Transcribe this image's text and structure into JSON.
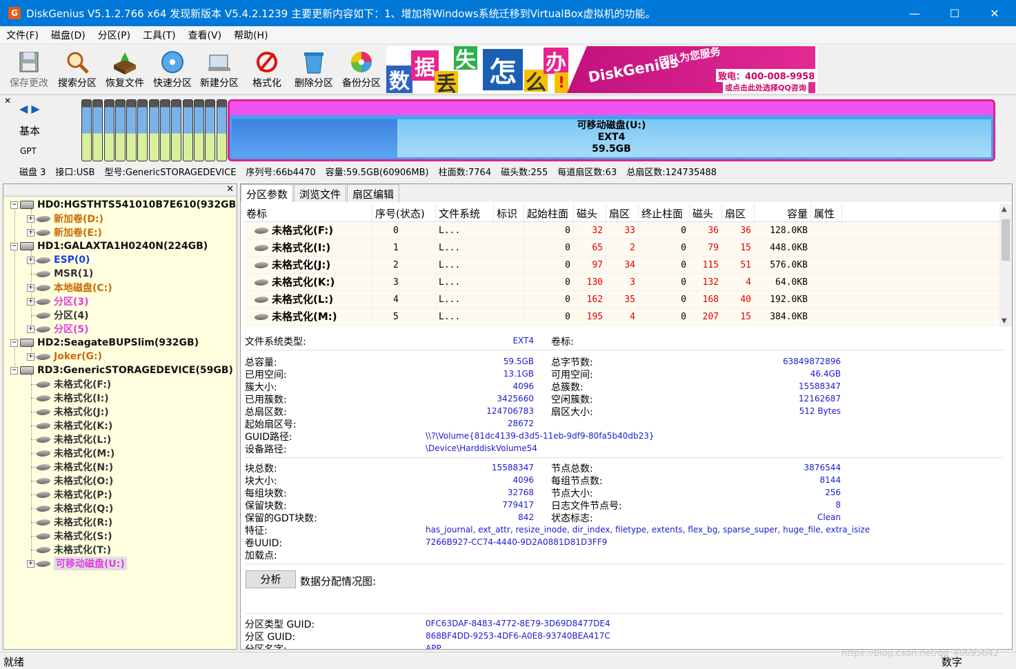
{
  "window": {
    "title": "DiskGenius V5.1.2.766 x64    发现新版本 V5.4.2.1239 主要更新内容如下：1、增加将Windows系统迁移到VirtualBox虚拟机的功能。",
    "icon": "G",
    "minimize": "—",
    "maximize": "☐",
    "close": "✕"
  },
  "menu": [
    "文件(F)",
    "磁盘(D)",
    "分区(P)",
    "工具(T)",
    "查看(V)",
    "帮助(H)"
  ],
  "toolbar": [
    {
      "label": "保存更改",
      "icon": "save-icon",
      "disabled": true
    },
    {
      "label": "搜索分区",
      "icon": "search-icon"
    },
    {
      "label": "恢复文件",
      "icon": "recover-icon"
    },
    {
      "label": "快速分区",
      "icon": "quick-partition-icon"
    },
    {
      "label": "新建分区",
      "icon": "new-partition-icon"
    },
    {
      "label": "格式化",
      "icon": "format-icon"
    },
    {
      "label": "删除分区",
      "icon": "delete-icon"
    },
    {
      "label": "备份分区",
      "icon": "backup-icon"
    }
  ],
  "banner": {
    "chars": [
      "数",
      "据",
      "丢",
      "失",
      "怎",
      "么",
      "办",
      "!"
    ],
    "brand": "DiskGenius",
    "service": "团队为您服务",
    "phone": "致电：400-008-9958",
    "qq": "或点击此处选择QQ咨询"
  },
  "disk": {
    "type": "基本",
    "style": "GPT",
    "partition_name": "可移动磁盘(U:)",
    "partition_fs": "EXT4",
    "partition_size": "59.5GB",
    "info": {
      "disk": "磁盘 3",
      "interface": "接口:USB",
      "model": "型号:GenericSTORAGEDEVICE",
      "serial": "序列号:66b4470",
      "capacity": "容量:59.5GB(60906MB)",
      "cylinders": "柱面数:7764",
      "heads": "磁头数:255",
      "sectors_per_track": "每道扇区数:63",
      "total_sectors": "总扇区数:124735488"
    }
  },
  "tree": [
    {
      "label": "HD0:HGSTHTS541010B7E610(932GB)",
      "level": 0,
      "kind": "disk",
      "color": "black",
      "exp": "−"
    },
    {
      "label": "新加卷(D:)",
      "level": 1,
      "kind": "part",
      "color": "orange",
      "exp": "+"
    },
    {
      "label": "新加卷(E:)",
      "level": 1,
      "kind": "part",
      "color": "orange",
      "exp": "+"
    },
    {
      "label": "HD1:GALAXTA1H0240N(224GB)",
      "level": 0,
      "kind": "disk",
      "color": "black",
      "exp": "−"
    },
    {
      "label": "ESP(0)",
      "level": 1,
      "kind": "part",
      "color": "blue",
      "exp": "+"
    },
    {
      "label": "MSR(1)",
      "level": 1,
      "kind": "part",
      "color": "gray",
      "exp": ""
    },
    {
      "label": "本地磁盘(C:)",
      "level": 1,
      "kind": "part",
      "color": "orange",
      "exp": "+"
    },
    {
      "label": "分区(3)",
      "level": 1,
      "kind": "part",
      "color": "magenta",
      "exp": "+"
    },
    {
      "label": "分区(4)",
      "level": 1,
      "kind": "part",
      "color": "gray",
      "exp": ""
    },
    {
      "label": "分区(5)",
      "level": 1,
      "kind": "part",
      "color": "magenta",
      "exp": "+"
    },
    {
      "label": "HD2:SeagateBUPSlim(932GB)",
      "level": 0,
      "kind": "disk",
      "color": "black",
      "exp": "−"
    },
    {
      "label": "Joker(G:)",
      "level": 1,
      "kind": "part",
      "color": "orange",
      "exp": "+"
    },
    {
      "label": "RD3:GenericSTORAGEDEVICE(59GB)",
      "level": 0,
      "kind": "disk",
      "color": "black",
      "exp": "−"
    },
    {
      "label": "未格式化(F:)",
      "level": 1,
      "kind": "part",
      "color": "gray",
      "exp": ""
    },
    {
      "label": "未格式化(I:)",
      "level": 1,
      "kind": "part",
      "color": "gray",
      "exp": ""
    },
    {
      "label": "未格式化(J:)",
      "level": 1,
      "kind": "part",
      "color": "gray",
      "exp": ""
    },
    {
      "label": "未格式化(K:)",
      "level": 1,
      "kind": "part",
      "color": "gray",
      "exp": ""
    },
    {
      "label": "未格式化(L:)",
      "level": 1,
      "kind": "part",
      "color": "gray",
      "exp": ""
    },
    {
      "label": "未格式化(M:)",
      "level": 1,
      "kind": "part",
      "color": "gray",
      "exp": ""
    },
    {
      "label": "未格式化(N:)",
      "level": 1,
      "kind": "part",
      "color": "gray",
      "exp": ""
    },
    {
      "label": "未格式化(O:)",
      "level": 1,
      "kind": "part",
      "color": "gray",
      "exp": ""
    },
    {
      "label": "未格式化(P:)",
      "level": 1,
      "kind": "part",
      "color": "gray",
      "exp": ""
    },
    {
      "label": "未格式化(Q:)",
      "level": 1,
      "kind": "part",
      "color": "gray",
      "exp": ""
    },
    {
      "label": "未格式化(R:)",
      "level": 1,
      "kind": "part",
      "color": "gray",
      "exp": ""
    },
    {
      "label": "未格式化(S:)",
      "level": 1,
      "kind": "part",
      "color": "gray",
      "exp": ""
    },
    {
      "label": "未格式化(T:)",
      "level": 1,
      "kind": "part",
      "color": "gray",
      "exp": ""
    },
    {
      "label": "可移动磁盘(U:)",
      "level": 1,
      "kind": "part",
      "color": "magenta",
      "exp": "+",
      "selected": true
    }
  ],
  "tabs": [
    "分区参数",
    "浏览文件",
    "扇区编辑"
  ],
  "table": {
    "headers": [
      "卷标",
      "序号(状态)",
      "文件系统",
      "标识",
      "起始柱面",
      "磁头",
      "扇区",
      "终止柱面",
      "磁头",
      "扇区",
      "容量",
      "属性"
    ],
    "rows": [
      [
        "未格式化(F:)",
        "0",
        "L...",
        "",
        "0",
        "32",
        "33",
        "0",
        "36",
        "36",
        "128.0KB",
        ""
      ],
      [
        "未格式化(I:)",
        "1",
        "L...",
        "",
        "0",
        "65",
        "2",
        "0",
        "79",
        "15",
        "448.0KB",
        ""
      ],
      [
        "未格式化(J:)",
        "2",
        "L...",
        "",
        "0",
        "97",
        "34",
        "0",
        "115",
        "51",
        "576.0KB",
        ""
      ],
      [
        "未格式化(K:)",
        "3",
        "L...",
        "",
        "0",
        "130",
        "3",
        "0",
        "132",
        "4",
        "64.0KB",
        ""
      ],
      [
        "未格式化(L:)",
        "4",
        "L...",
        "",
        "0",
        "162",
        "35",
        "0",
        "168",
        "40",
        "192.0KB",
        ""
      ],
      [
        "未格式化(M:)",
        "5",
        "L...",
        "",
        "0",
        "195",
        "4",
        "0",
        "207",
        "15",
        "384.0KB",
        ""
      ]
    ]
  },
  "fs": {
    "type_label": "文件系统类型:",
    "type_value": "EXT4",
    "volume_label": "卷标:",
    "total_cap_label": "总容量:",
    "total_cap": "59.5GB",
    "total_bytes_label": "总字节数:",
    "total_bytes": "63849872896",
    "used_label": "已用空间:",
    "used": "13.1GB",
    "free_label": "可用空间:",
    "free": "46.4GB",
    "cluster_size_label": "簇大小:",
    "cluster_size": "4096",
    "total_clusters_label": "总簇数:",
    "total_clusters": "15588347",
    "used_clusters_label": "已用簇数:",
    "used_clusters": "3425660",
    "free_clusters_label": "空闲簇数:",
    "free_clusters": "12162687",
    "total_sectors_label": "总扇区数:",
    "total_sectors": "124706783",
    "sector_size_label": "扇区大小:",
    "sector_size": "512 Bytes",
    "start_sector_label": "起始扇区号:",
    "start_sector": "28672",
    "guid_path_label": "GUID路径:",
    "guid_path": "\\\\?\\Volume{81dc4139-d3d5-11eb-9df9-80fa5b40db23}",
    "device_path_label": "设备路径:",
    "device_path": "\\Device\\HarddiskVolume54"
  },
  "ext": {
    "blocks_label": "块总数:",
    "blocks": "15588347",
    "inodes_label": "节点总数:",
    "inodes": "3876544",
    "block_size_label": "块大小:",
    "block_size": "4096",
    "inodes_per_group_label": "每组节点数:",
    "inodes_per_group": "8144",
    "blocks_per_group_label": "每组块数:",
    "blocks_per_group": "32768",
    "inode_size_label": "节点大小:",
    "inode_size": "256",
    "reserved_blocks_label": "保留块数:",
    "reserved_blocks": "779417",
    "journal_inode_label": "日志文件节点号:",
    "journal_inode": "8",
    "reserved_gdt_label": "保留的GDT块数:",
    "reserved_gdt": "842",
    "state_label": "状态标志:",
    "state": "Clean",
    "features_label": "特征:",
    "features": "has_journal, ext_attr, resize_inode, dir_index, filetype, extents, flex_bg, sparse_super, huge_file, extra_isize",
    "uuid_label": "卷UUID:",
    "uuid": "7266B927-CC74-4440-9D2A0881D81D3FF9",
    "mount_label": "加载点:"
  },
  "analyze": {
    "button": "分析",
    "label": "数据分配情况图:"
  },
  "gpt": {
    "type_guid_label": "分区类型 GUID:",
    "type_guid": "0FC63DAF-8483-4772-8E79-3D69D8477DE4",
    "part_guid_label": "分区 GUID:",
    "part_guid": "868BF4DD-9253-4DF6-A0E8-93740BEA417C",
    "name_label": "分区名字:",
    "name": "APP"
  },
  "status": {
    "text": "就绪",
    "numlock": "数字",
    "watermark": "https://blog.csdn.net/qq_40695642"
  }
}
